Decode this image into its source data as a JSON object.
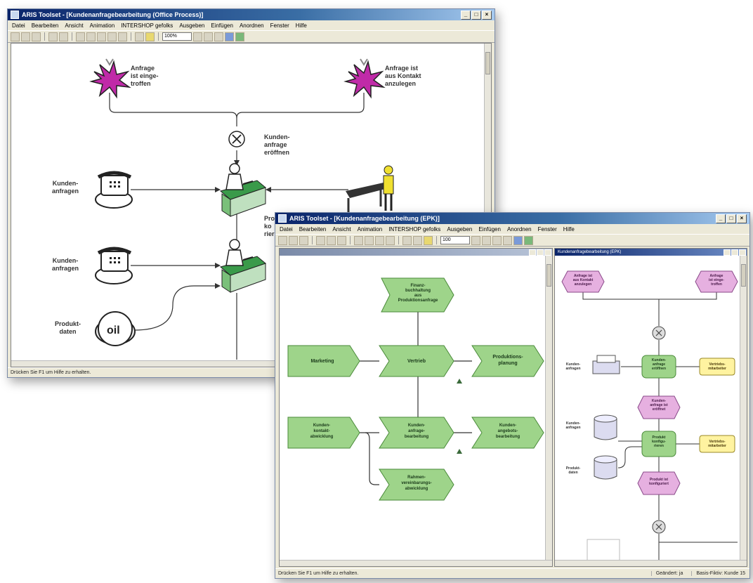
{
  "back_window": {
    "title": "ARIS Toolset - [Kundenanfragebearbeitung (Office Process)]",
    "menu": [
      "Datei",
      "Bearbeiten",
      "Ansicht",
      "Animation",
      "INTERSHOP gefolks",
      "Ausgeben",
      "Einfügen",
      "Anordnen",
      "Fenster",
      "Hilfe"
    ],
    "zoom": "100%",
    "status": "Drücken Sie F1 um Hilfe zu erhalten.",
    "labels": {
      "event1": "Anfrage\nist einge-\ntroffen",
      "event2": "Anfrage ist\naus Kontakt\nanzulegen",
      "xor": "X",
      "func1": "Kunden-\nanfrage\neröffnen",
      "input1": "Kunden-\nanfragen",
      "input2": "Kunden-\nanfragen",
      "input3": "Produkt-\ndaten",
      "partial": "Pro\nko\nrier"
    }
  },
  "front_window": {
    "title": "ARIS Toolset - [Kundenanfragebearbeitung (EPK)]",
    "menu": [
      "Datei",
      "Bearbeiten",
      "Ansicht",
      "Animation",
      "INTERSHOP gefolks",
      "Ausgeben",
      "Einfügen",
      "Anordnen",
      "Fenster",
      "Hilfe"
    ],
    "zoom": "100",
    "status": "Drücken Sie F1 um Hilfe zu erhalten.",
    "status_right": [
      "Geändert: ja",
      "Basis-Fiktiv: Kunde 15"
    ],
    "left_pane": {
      "title": "",
      "nodes": {
        "top": "Finanz-\nbuchhaltung\naus\nProduktionsanfrage",
        "marketing": "Marketing",
        "vertrieb": "Vertrieb",
        "produktionsplanung": "Produktions-\nplanung",
        "kontakt": "Kunden-\nkontakt-\nabwicklung",
        "anfrage": "Kunden-\nanfrage-\nbearbeitung",
        "angebot": "Kunden-\nangebots-\nbearbeitung",
        "bottom": "Rahmen-\nvereinbarungs-\nabwicklung"
      }
    },
    "right_pane": {
      "title": "Kundenanfragebearbeitung (EPK)",
      "nodes": {
        "ev1": "Anfrage ist\naus Kontakt\nanzulegen",
        "ev2": "Anfrage\nist einge-\ntroffen",
        "fn1": "Kunden-\nanfrage\neröffnen",
        "org1": "Vertriebs-\nmitarbeiter",
        "in1": "Kunden-\nanfragen",
        "ev3": "Kunden-\nanfrage ist\neröffnet",
        "in2": "Kunden-\nanfragen",
        "fn2": "Produkt\nkonfigu-\nrieren",
        "org2": "Vertriebs-\nmitarbeiter",
        "in3": "Produkt-\ndaten",
        "ev4": "Produkt ist\nkonfiguriert",
        "xor1": "",
        "xor2": ""
      }
    }
  },
  "colors": {
    "epc_green": "#9ed48a",
    "event_pink": "#e6b0e0",
    "org_yellow": "#fff3a0",
    "star_magenta": "#c02aa8",
    "desk_green": "#3a9a4a"
  }
}
